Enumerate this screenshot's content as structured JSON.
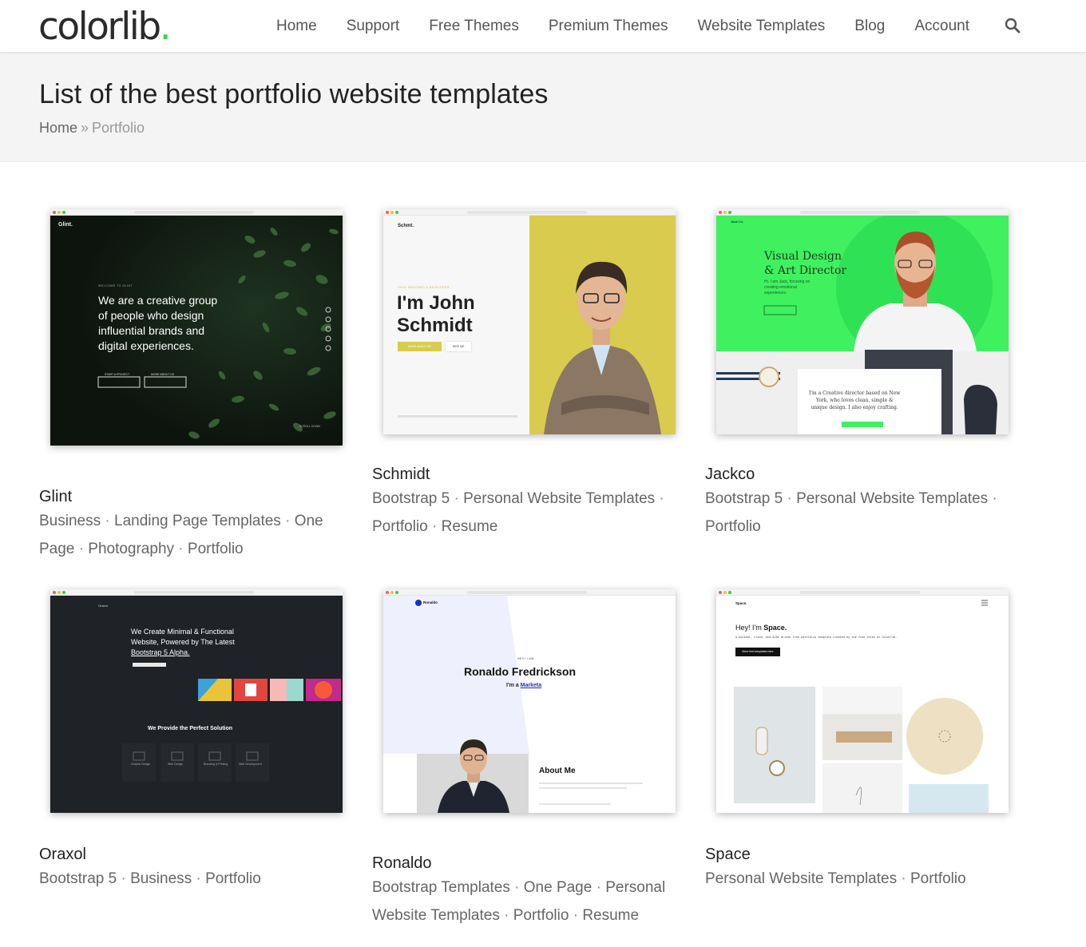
{
  "header": {
    "logo": "colorlib",
    "logo_dot": ".",
    "nav": [
      "Home",
      "Support",
      "Free Themes",
      "Premium Themes",
      "Website Templates",
      "Blog",
      "Account"
    ],
    "search_icon": "search-icon"
  },
  "title_band": {
    "title": "List of the best portfolio website templates",
    "breadcrumb": {
      "home": "Home",
      "separator": "»",
      "current": "Portfolio"
    }
  },
  "colors": {
    "accent_green": "#3ccf4e",
    "schmidt_yellow": "#d8cb4d",
    "jackco_green": "#3ff15f"
  },
  "cards": [
    {
      "title": "Glint",
      "tags": [
        "Business",
        "Landing Page Templates",
        "One Page",
        "Photography",
        "Portfolio"
      ],
      "preview": {
        "brand": "Glint.",
        "kicker": "WELCOME TO GLINT",
        "headline": [
          "We are a creative group",
          "of people who design",
          "influential brands and",
          "digital experiences."
        ],
        "buttons": [
          "START A PROJECT",
          "MORE ABOUT US"
        ],
        "footer": "SCROLL DOWN"
      }
    },
    {
      "title": "Schmidt",
      "tags": [
        "Bootstrap 5",
        "Personal Website Templates",
        "Portfolio",
        "Resume"
      ],
      "preview": {
        "brand": "Schmt.",
        "kicker": "UI/UX DESIGNER & DEVELOPER",
        "headline": [
          "I'm John",
          "Schmidt"
        ],
        "buttons": [
          "MORE ABOUT ME",
          "HIRE ME"
        ]
      }
    },
    {
      "title": "Jackco",
      "tags": [
        "Bootstrap 5",
        "Personal Website Templates",
        "Portfolio"
      ],
      "preview": {
        "brand": "Jack Co.",
        "headline": [
          "Visual Design",
          "& Art Director"
        ],
        "sub": [
          "Hi. I am Jack, focusing on",
          "creating emotional",
          "experiences."
        ],
        "quote": [
          "I'm a Creative director based on New",
          "York, who loves clean, simple &",
          "unique design. I also enjoy crafting."
        ]
      }
    },
    {
      "title": "Oraxol",
      "tags": [
        "Bootstrap 5",
        "Business",
        "Portfolio"
      ],
      "preview": {
        "brand": "Oraxol",
        "headline": [
          "We Create Minimal & Functional",
          "Website, Powered by The Latest",
          "Bootstrap 5 Alpha."
        ],
        "section": "We Provide the Perfect Solution",
        "services": [
          "Graphic Design",
          "Web Design",
          "Branding & Printing",
          "Web Development"
        ]
      }
    },
    {
      "title": "Ronaldo",
      "tags": [
        "Bootstrap Templates",
        "One Page",
        "Personal Website Templates",
        "Portfolio",
        "Resume"
      ],
      "preview": {
        "brand": "Ronaldo",
        "kicker": "HEY! I AM",
        "name": "Ronaldo Fredrickson",
        "role_prefix": "I'm a",
        "role": "Marketa",
        "about": "About Me"
      }
    },
    {
      "title": "Space",
      "tags": [
        "Personal Website Templates",
        "Portfolio"
      ],
      "preview": {
        "brand": "Space.",
        "greeting_prefix": "Hey! I'm",
        "greeting_name": "Space.",
        "sub": "A minimal, clean, and AJAX driven free portfolio template created by the fine folks at Colorlib.",
        "button": "More free templates here"
      }
    }
  ]
}
